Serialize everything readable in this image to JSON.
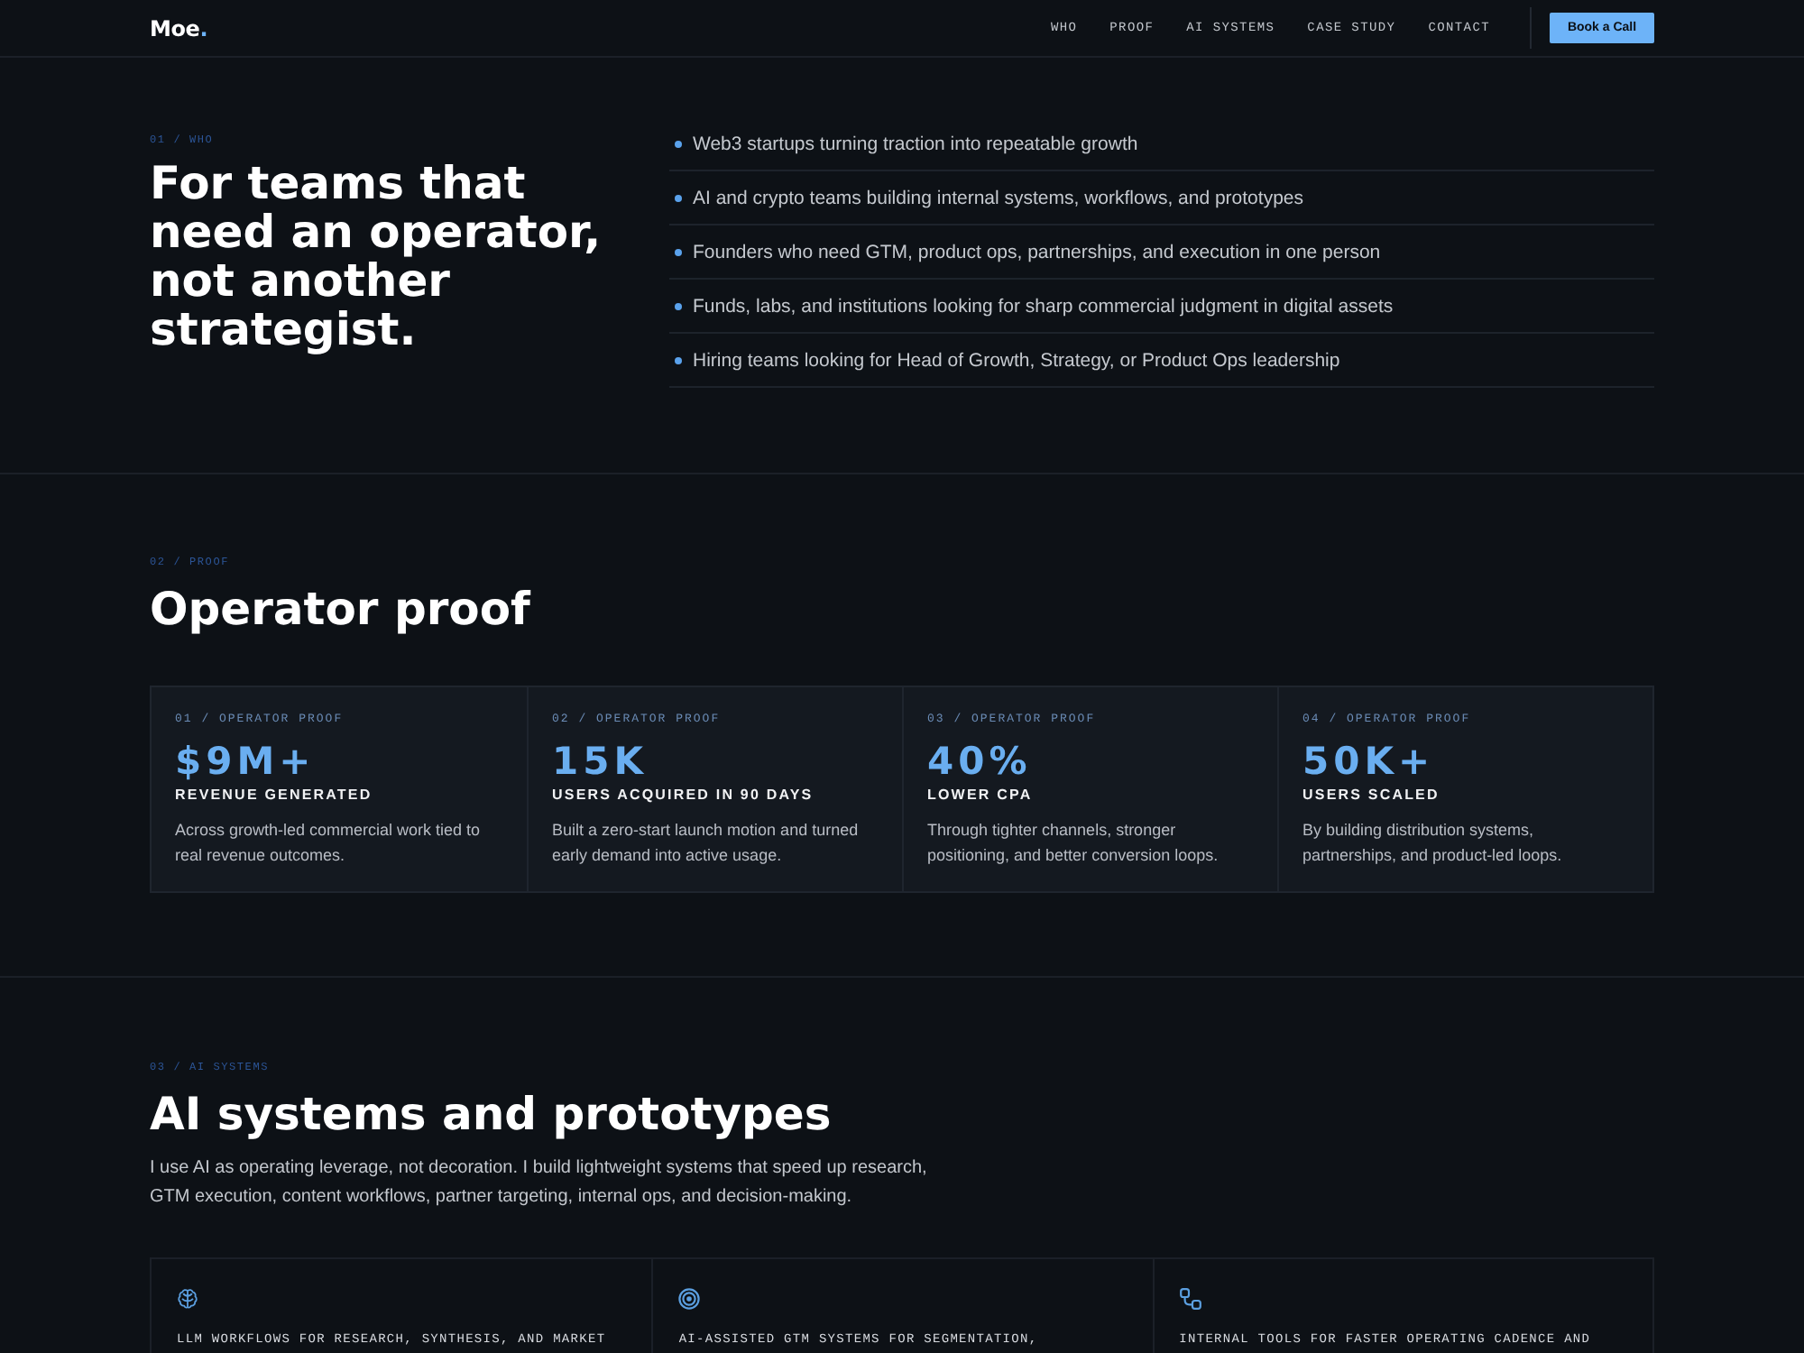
{
  "nav": {
    "logo": "Moe",
    "logo_dot": ".",
    "links": [
      {
        "label": "WHO"
      },
      {
        "label": "PROOF"
      },
      {
        "label": "AI SYSTEMS"
      },
      {
        "label": "CASE STUDY"
      },
      {
        "label": "CONTACT"
      }
    ],
    "cta": "Book a Call"
  },
  "who": {
    "eyebrow": "01 / WHO",
    "heading": "For teams that need an operator, not another strategist.",
    "items": [
      "Web3 startups turning traction into repeatable growth",
      "AI and crypto teams building internal systems, workflows, and prototypes",
      "Founders who need GTM, product ops, partnerships, and execution in one person",
      "Funds, labs, and institutions looking for sharp commercial judgment in digital assets",
      "Hiring teams looking for Head of Growth, Strategy, or Product Ops leadership"
    ]
  },
  "proof": {
    "eyebrow": "02 / PROOF",
    "heading": "Operator proof",
    "cards": [
      {
        "label": "01 / OPERATOR PROOF",
        "metric": "$9M+",
        "title": "REVENUE GENERATED",
        "text": "Across growth-led commercial work tied to real revenue outcomes."
      },
      {
        "label": "02 / OPERATOR PROOF",
        "metric": "15K",
        "title": "USERS ACQUIRED IN 90 DAYS",
        "text": "Built a zero-start launch motion and turned early demand into active usage."
      },
      {
        "label": "03 / OPERATOR PROOF",
        "metric": "40%",
        "title": "LOWER CPA",
        "text": "Through tighter channels, stronger positioning, and better conversion loops."
      },
      {
        "label": "04 / OPERATOR PROOF",
        "metric": "50K+",
        "title": "USERS SCALED",
        "text": "By building distribution systems, partnerships, and product-led loops."
      }
    ]
  },
  "ai_systems": {
    "eyebrow": "03 / AI SYSTEMS",
    "heading": "AI systems and prototypes",
    "intro": "I use AI as operating leverage, not decoration. I build lightweight systems that speed up research, GTM execution, content workflows, partner targeting, internal ops, and decision-making.",
    "cards": [
      {
        "title": "LLM WORKFLOWS FOR RESEARCH, SYNTHESIS, AND MARKET"
      },
      {
        "title": "AI-ASSISTED GTM SYSTEMS FOR SEGMENTATION,"
      },
      {
        "title": "INTERNAL TOOLS FOR FASTER OPERATING CADENCE AND"
      }
    ]
  }
}
